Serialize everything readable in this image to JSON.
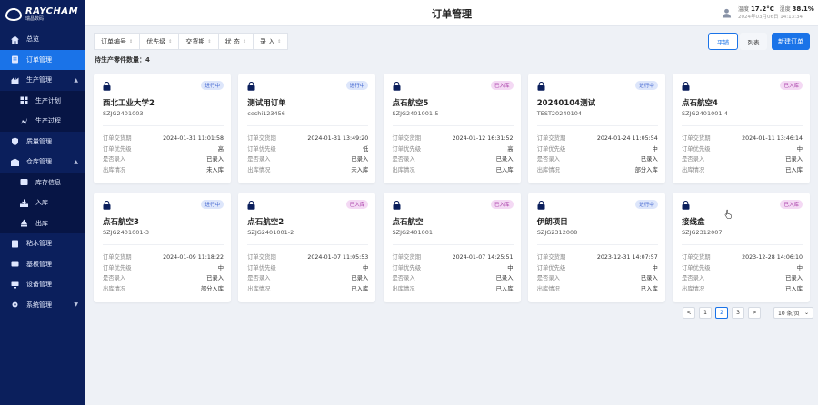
{
  "app": {
    "brand": "RAYCHAM",
    "brand_sub": "瑞昌数码"
  },
  "sidebar": {
    "items": [
      {
        "label": "总览",
        "icon": "home-icon"
      },
      {
        "label": "订单管理",
        "icon": "order-icon",
        "active": true
      },
      {
        "label": "生产管理",
        "icon": "production-icon",
        "expanded": true
      },
      {
        "label": "生产计划",
        "icon": "plan-icon",
        "sub": true
      },
      {
        "label": "生产过程",
        "icon": "process-icon",
        "sub": true
      },
      {
        "label": "质量管理",
        "icon": "shield-icon"
      },
      {
        "label": "仓库管理",
        "icon": "warehouse-icon",
        "expanded": true
      },
      {
        "label": "库存信息",
        "icon": "inventory-icon",
        "sub": true
      },
      {
        "label": "入库",
        "icon": "inbound-icon",
        "sub": true
      },
      {
        "label": "出库",
        "icon": "outbound-icon",
        "sub": true
      },
      {
        "label": "粘木管理",
        "icon": "book-icon"
      },
      {
        "label": "基板管理",
        "icon": "board-icon"
      },
      {
        "label": "设备管理",
        "icon": "device-icon"
      },
      {
        "label": "系统管理",
        "icon": "gear-icon",
        "collapsed": true
      }
    ]
  },
  "header": {
    "title": "订单管理",
    "temp_label": "温度",
    "temp_value": "17.2°C",
    "humidity_label": "湿度",
    "humidity_value": "38.1%",
    "datetime": "2024年03月06日 14:13:34"
  },
  "toolbar": {
    "filters": [
      "订单编号",
      "优先级",
      "交货期",
      "状 态",
      "录 入"
    ],
    "tile_label": "平铺",
    "list_label": "列表",
    "new_label": "新建订单"
  },
  "count_line": "待生产零件数量：4",
  "field_labels": {
    "delivery": "订单交货期",
    "priority": "订单优先级",
    "entered": "是否录入",
    "outbound": "出库情况"
  },
  "orders": [
    {
      "badge": "进行中",
      "status": "blue",
      "title": "西北工业大学2",
      "code": "SZJG2401003",
      "delivery": "2024-01-31 11:01:58",
      "priority": "高",
      "entered": "已录入",
      "outbound": "未入库"
    },
    {
      "badge": "进行中",
      "status": "blue",
      "title": "测试用订单",
      "code": "ceshi123456",
      "delivery": "2024-01-31 13:49:20",
      "priority": "低",
      "entered": "已录入",
      "outbound": "未入库"
    },
    {
      "badge": "已入库",
      "status": "pink",
      "title": "点石航空5",
      "code": "SZJG2401001-5",
      "delivery": "2024-01-12 16:31:52",
      "priority": "高",
      "entered": "已录入",
      "outbound": "已入库"
    },
    {
      "badge": "进行中",
      "status": "blue",
      "title": "20240104测试",
      "code": "TEST20240104",
      "delivery": "2024-01-24 11:05:54",
      "priority": "中",
      "entered": "已录入",
      "outbound": "部分入库"
    },
    {
      "badge": "已入库",
      "status": "pink",
      "title": "点石航空4",
      "code": "SZJG2401001-4",
      "delivery": "2024-01-11 13:46:14",
      "priority": "中",
      "entered": "已录入",
      "outbound": "已入库"
    },
    {
      "badge": "进行中",
      "status": "blue",
      "title": "点石航空3",
      "code": "SZJG2401001-3",
      "delivery": "2024-01-09 11:18:22",
      "priority": "中",
      "entered": "已录入",
      "outbound": "部分入库"
    },
    {
      "badge": "已入库",
      "status": "pink",
      "title": "点石航空2",
      "code": "SZJG2401001-2",
      "delivery": "2024-01-07 11:05:53",
      "priority": "中",
      "entered": "已录入",
      "outbound": "已入库"
    },
    {
      "badge": "已入库",
      "status": "pink",
      "title": "点石航空",
      "code": "SZJG2401001",
      "delivery": "2024-01-07 14:25:51",
      "priority": "中",
      "entered": "已录入",
      "outbound": "已入库"
    },
    {
      "badge": "进行中",
      "status": "blue",
      "title": "伊朗项目",
      "code": "SZJG2312008",
      "delivery": "2023-12-31 14:07:57",
      "priority": "中",
      "entered": "已录入",
      "outbound": "已入库"
    },
    {
      "badge": "已入库",
      "status": "pink",
      "title": "接线盒",
      "code": "SZJG2312007",
      "delivery": "2023-12-28 14:06:10",
      "priority": "中",
      "entered": "已录入",
      "outbound": "已入库"
    }
  ],
  "pagination": {
    "prev": "<",
    "pages": [
      "1",
      "2",
      "3"
    ],
    "current": "2",
    "next": ">",
    "page_size": "10 条/页"
  },
  "colors": {
    "sidebar_bg": "#0b1f5c",
    "accent": "#1a73e8",
    "badge_blue": "#dde6fb",
    "badge_pink": "#f4d9f4"
  }
}
